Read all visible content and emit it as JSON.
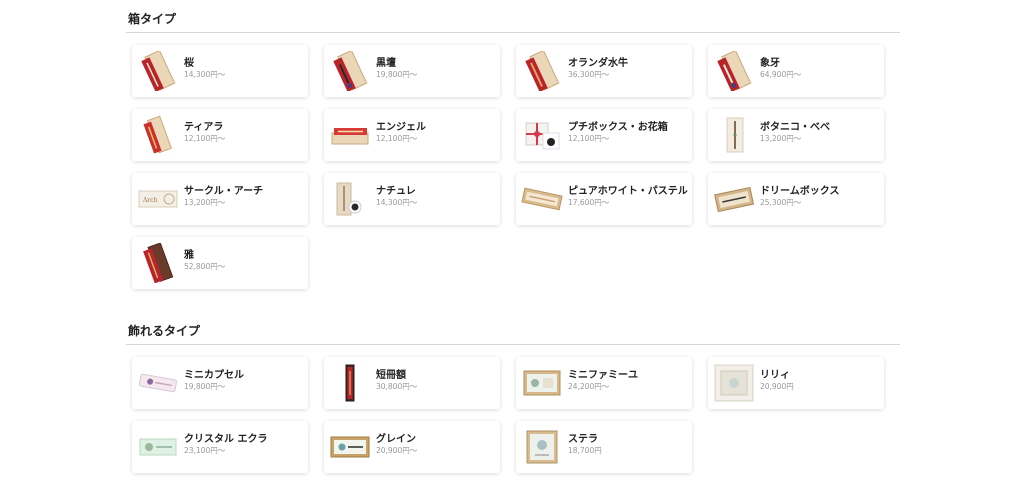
{
  "sections": [
    {
      "title": "箱タイプ",
      "items": [
        {
          "name": "桜",
          "price": "14,300円〜",
          "icon": "sakura-box-thumbnail-icon"
        },
        {
          "name": "黒壇",
          "price": "19,800円〜",
          "icon": "kokutan-box-thumbnail-icon"
        },
        {
          "name": "オランダ水牛",
          "price": "36,300円〜",
          "icon": "oranda-suigyu-box-thumbnail-icon"
        },
        {
          "name": "象牙",
          "price": "64,900円〜",
          "icon": "zouge-box-thumbnail-icon"
        },
        {
          "name": "ティアラ",
          "price": "12,100円〜",
          "icon": "tiara-box-thumbnail-icon"
        },
        {
          "name": "エンジェル",
          "price": "12,100円〜",
          "icon": "angel-box-thumbnail-icon"
        },
        {
          "name": "プチボックス・お花箱",
          "price": "12,100円〜",
          "icon": "petit-box-thumbnail-icon"
        },
        {
          "name": "ボタニコ・べべ",
          "price": "13,200円〜",
          "icon": "botanico-bebe-thumbnail-icon"
        },
        {
          "name": "サークル・アーチ",
          "price": "13,200円〜",
          "icon": "circle-arch-thumbnail-icon"
        },
        {
          "name": "ナチュレ",
          "price": "14,300円〜",
          "icon": "nature-thumbnail-icon"
        },
        {
          "name": "ピュアホワイト・パステル",
          "price": "17,600円〜",
          "icon": "pure-white-pastel-thumbnail-icon"
        },
        {
          "name": "ドリームボックス",
          "price": "25,300円〜",
          "icon": "dream-box-thumbnail-icon"
        },
        {
          "name": "雅",
          "price": "52,800円〜",
          "icon": "miyabi-box-thumbnail-icon"
        }
      ]
    },
    {
      "title": "飾れるタイプ",
      "items": [
        {
          "name": "ミニカプセル",
          "price": "19,800円〜",
          "icon": "mini-capsule-thumbnail-icon"
        },
        {
          "name": "短冊額",
          "price": "30,800円〜",
          "icon": "tanzaku-frame-thumbnail-icon"
        },
        {
          "name": "ミニファミーユ",
          "price": "24,200円〜",
          "icon": "mini-famille-thumbnail-icon"
        },
        {
          "name": "リリィ",
          "price": "20,900円",
          "icon": "lily-thumbnail-icon"
        },
        {
          "name": "クリスタル エクラ",
          "price": "23,100円〜",
          "icon": "crystal-eclat-thumbnail-icon"
        },
        {
          "name": "グレイン",
          "price": "20,900円〜",
          "icon": "grain-thumbnail-icon"
        },
        {
          "name": "ステラ",
          "price": "18,700円",
          "icon": "stella-thumbnail-icon"
        }
      ]
    }
  ],
  "colors": {
    "text": "#222222",
    "price": "#999999",
    "divider": "#d6d6d6",
    "wood": "#e4c9a3",
    "red": "#b8242b"
  }
}
